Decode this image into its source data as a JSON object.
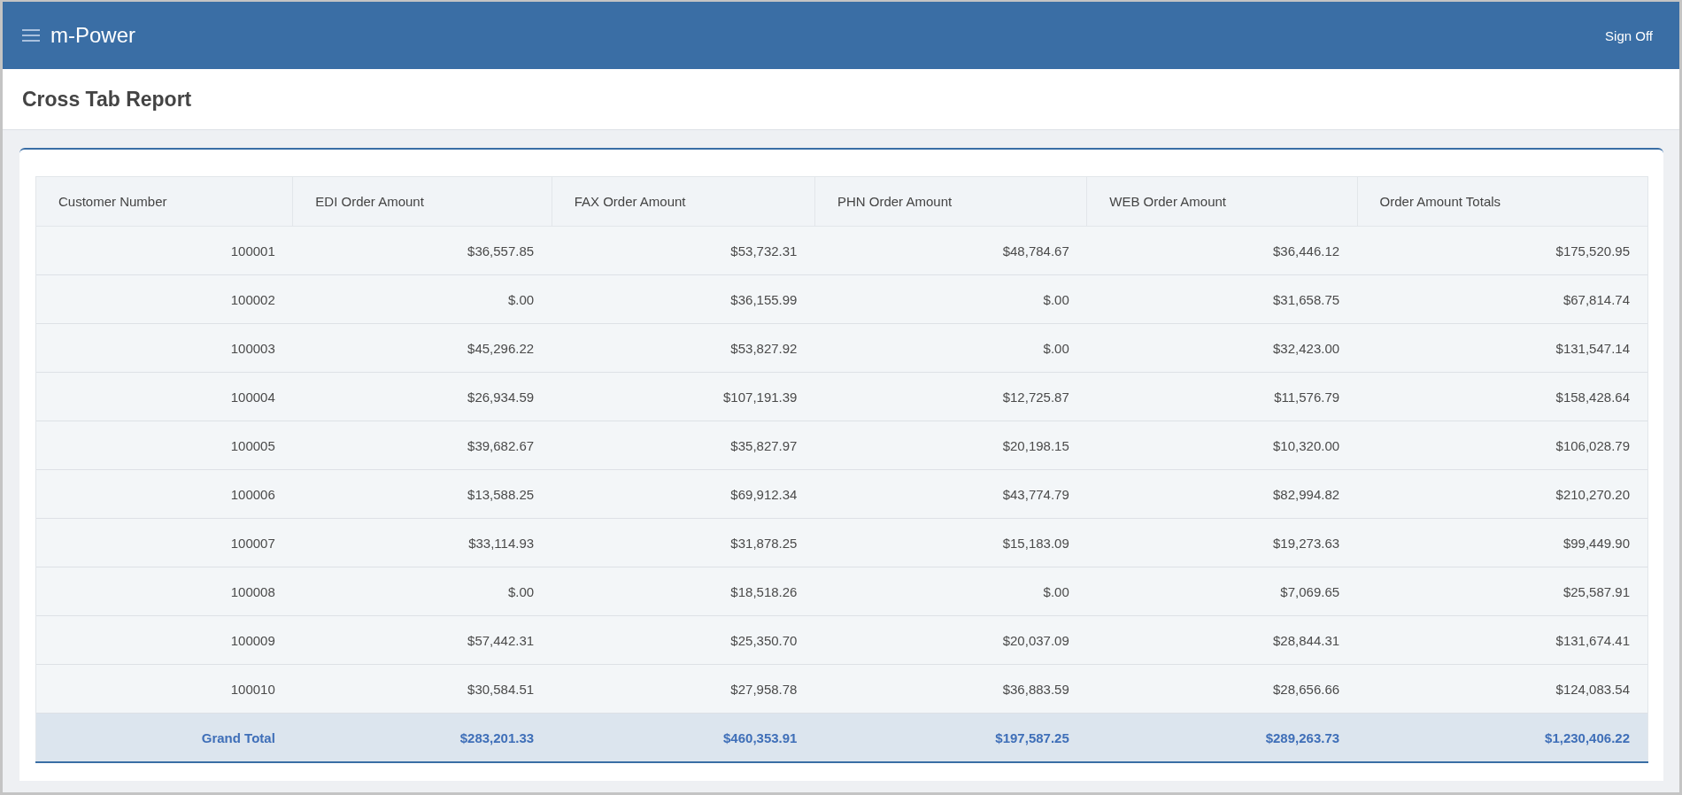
{
  "app": {
    "title": "m-Power",
    "sign_off": "Sign Off"
  },
  "page": {
    "title": "Cross Tab Report"
  },
  "table": {
    "columns": [
      "Customer Number",
      "EDI Order Amount",
      "FAX Order Amount",
      "PHN Order Amount",
      "WEB Order Amount",
      "Order Amount Totals"
    ],
    "rows": [
      [
        "100001",
        "$36,557.85",
        "$53,732.31",
        "$48,784.67",
        "$36,446.12",
        "$175,520.95"
      ],
      [
        "100002",
        "$.00",
        "$36,155.99",
        "$.00",
        "$31,658.75",
        "$67,814.74"
      ],
      [
        "100003",
        "$45,296.22",
        "$53,827.92",
        "$.00",
        "$32,423.00",
        "$131,547.14"
      ],
      [
        "100004",
        "$26,934.59",
        "$107,191.39",
        "$12,725.87",
        "$11,576.79",
        "$158,428.64"
      ],
      [
        "100005",
        "$39,682.67",
        "$35,827.97",
        "$20,198.15",
        "$10,320.00",
        "$106,028.79"
      ],
      [
        "100006",
        "$13,588.25",
        "$69,912.34",
        "$43,774.79",
        "$82,994.82",
        "$210,270.20"
      ],
      [
        "100007",
        "$33,114.93",
        "$31,878.25",
        "$15,183.09",
        "$19,273.63",
        "$99,449.90"
      ],
      [
        "100008",
        "$.00",
        "$18,518.26",
        "$.00",
        "$7,069.65",
        "$25,587.91"
      ],
      [
        "100009",
        "$57,442.31",
        "$25,350.70",
        "$20,037.09",
        "$28,844.31",
        "$131,674.41"
      ],
      [
        "100010",
        "$30,584.51",
        "$27,958.78",
        "$36,883.59",
        "$28,656.66",
        "$124,083.54"
      ]
    ],
    "grand_total": [
      "Grand Total",
      "$283,201.33",
      "$460,353.91",
      "$197,587.25",
      "$289,263.73",
      "$1,230,406.22"
    ]
  }
}
